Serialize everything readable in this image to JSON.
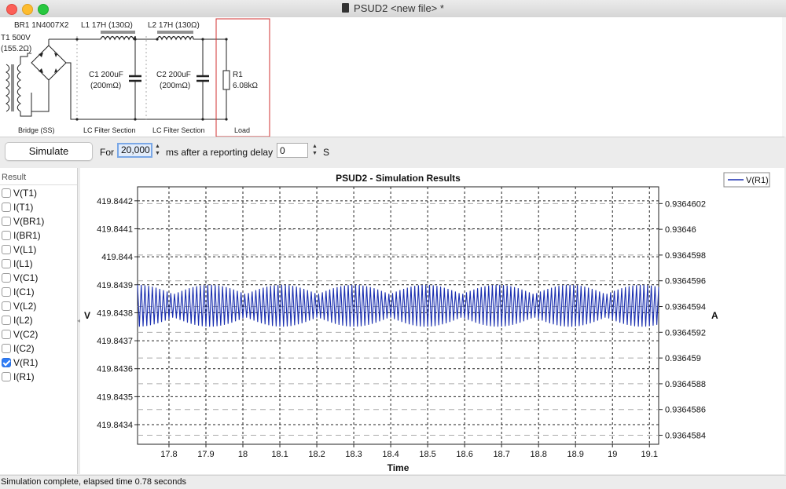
{
  "window": {
    "title": "PSUD2  <new file> *"
  },
  "schematic": {
    "t1_label": "T1 500V",
    "t1_res": "(155.2Ω)",
    "br1_label": "BR1 1N4007X2",
    "l1_label": "L1 17H (130Ω)",
    "l2_label": "L2 17H (130Ω)",
    "c1_label": "C1 200uF",
    "c1_res": "(200mΩ)",
    "c2_label": "C2 200uF",
    "c2_res": "(200mΩ)",
    "r1_label": "R1",
    "r1_value": "6.08kΩ",
    "sections": [
      "Bridge (SS)",
      "LC Filter Section",
      "LC Filter Section",
      "Load"
    ]
  },
  "toolbar": {
    "simulate_label": "Simulate",
    "for_label": "For",
    "duration_value": "20,000",
    "after_label": "ms after a reporting delay",
    "delay_value": "0",
    "unit_label": "S"
  },
  "results": {
    "header": "Result",
    "items": [
      {
        "label": "V(T1)",
        "checked": false
      },
      {
        "label": "I(T1)",
        "checked": false
      },
      {
        "label": "V(BR1)",
        "checked": false
      },
      {
        "label": "I(BR1)",
        "checked": false
      },
      {
        "label": "V(L1)",
        "checked": false
      },
      {
        "label": "I(L1)",
        "checked": false
      },
      {
        "label": "V(C1)",
        "checked": false
      },
      {
        "label": "I(C1)",
        "checked": false
      },
      {
        "label": "V(L2)",
        "checked": false
      },
      {
        "label": "I(L2)",
        "checked": false
      },
      {
        "label": "V(C2)",
        "checked": false
      },
      {
        "label": "I(C2)",
        "checked": false
      },
      {
        "label": "V(R1)",
        "checked": true
      },
      {
        "label": "I(R1)",
        "checked": false
      }
    ]
  },
  "chart_data": {
    "type": "line",
    "title": "PSUD2 - Simulation Results",
    "xlabel": "Time",
    "ylabel": "V",
    "y2label": "A",
    "xlim": [
      17.715,
      19.125
    ],
    "ylim": [
      419.84333,
      419.84425
    ],
    "y2lim": [
      0.93645833,
      0.93646033
    ],
    "xticks": [
      "17.8",
      "17.9",
      "18",
      "18.1",
      "18.2",
      "18.3",
      "18.4",
      "18.5",
      "18.6",
      "18.7",
      "18.8",
      "18.9",
      "19",
      "19.1"
    ],
    "yticks": [
      "419.8442",
      "419.8441",
      "419.844",
      "419.8439",
      "419.8438",
      "419.8437",
      "419.8436",
      "419.8435",
      "419.8434"
    ],
    "y2ticks": [
      "0.9364602",
      "0.93646",
      "0.9364598",
      "0.9364596",
      "0.9364594",
      "0.9364592",
      "0.936459",
      "0.9364588",
      "0.9364586",
      "0.9364584"
    ],
    "grid": true,
    "legend": "top-right",
    "series": [
      {
        "name": "V(R1)",
        "color": "#1a2fb0",
        "ripple_period": 0.01,
        "y_max": 419.8439,
        "y_min": 419.84375
      }
    ]
  },
  "status": {
    "text": "Simulation complete, elapsed time 0.78 seconds"
  }
}
